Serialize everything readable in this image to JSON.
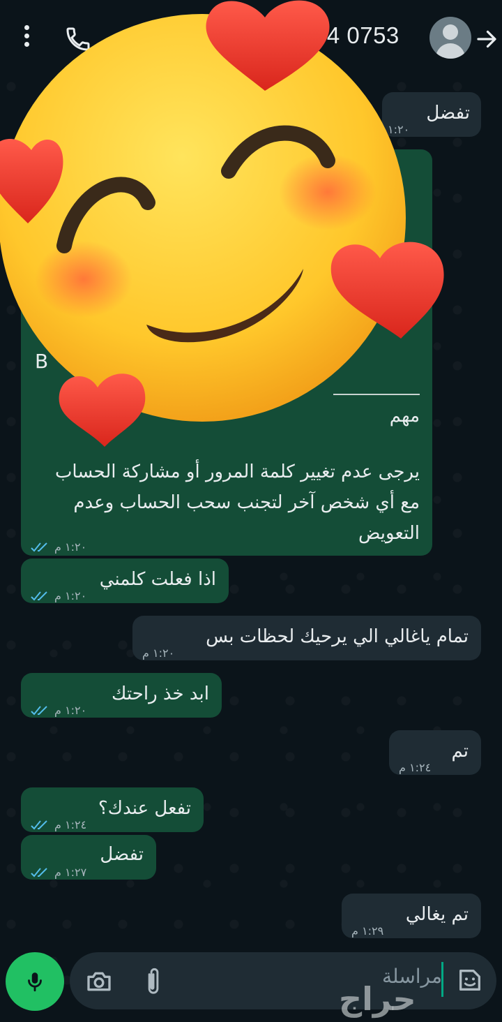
{
  "header": {
    "number": "74 0753",
    "back_icon": "arrow-right-icon",
    "avatar_icon": "person-avatar-icon",
    "call_icon": "phone-icon",
    "menu_icon": "more-vertical-icon"
  },
  "messages": [
    {
      "side": "in",
      "text": "تفضل",
      "time": "١:٢٠"
    },
    {
      "side": "out",
      "text_partial": "B",
      "heading": "مهم",
      "body": [
        "يرجى عدم تغيير كلمة المرور أو مشاركة الحساب",
        "مع أي شخص آخر لتجنب سحب الحساب وعدم",
        "التعويض"
      ],
      "time": "١:٢٠ م"
    },
    {
      "side": "out",
      "text": "اذا فعلت كلمني",
      "time": "١:٢٠ م"
    },
    {
      "side": "in",
      "text": "تمام ياغالي الي يرحيك لحظات بس",
      "time": "١:٢٠ م"
    },
    {
      "side": "out",
      "text": "ابد خذ راحتك",
      "time": "١:٢٠ م"
    },
    {
      "side": "in",
      "text": "تم",
      "time": "١:٢٤ م"
    },
    {
      "side": "out",
      "text": "تفعل عندك؟",
      "time": "١:٢٤ م"
    },
    {
      "side": "out",
      "text": "تفضل",
      "time": "١:٢٧ م"
    },
    {
      "side": "in",
      "text": "تم يغالي",
      "time": "١:٢٩ م"
    }
  ],
  "input": {
    "placeholder": "مراسلة",
    "camera_icon": "camera-icon",
    "attach_icon": "paperclip-icon",
    "sticker_icon": "sticker-icon",
    "mic_icon": "microphone-icon"
  },
  "watermark": "حراج",
  "colors": {
    "background": "#0b141a",
    "incoming": "#1f2c34",
    "outgoing": "#005c4b",
    "accent": "#21c063"
  }
}
